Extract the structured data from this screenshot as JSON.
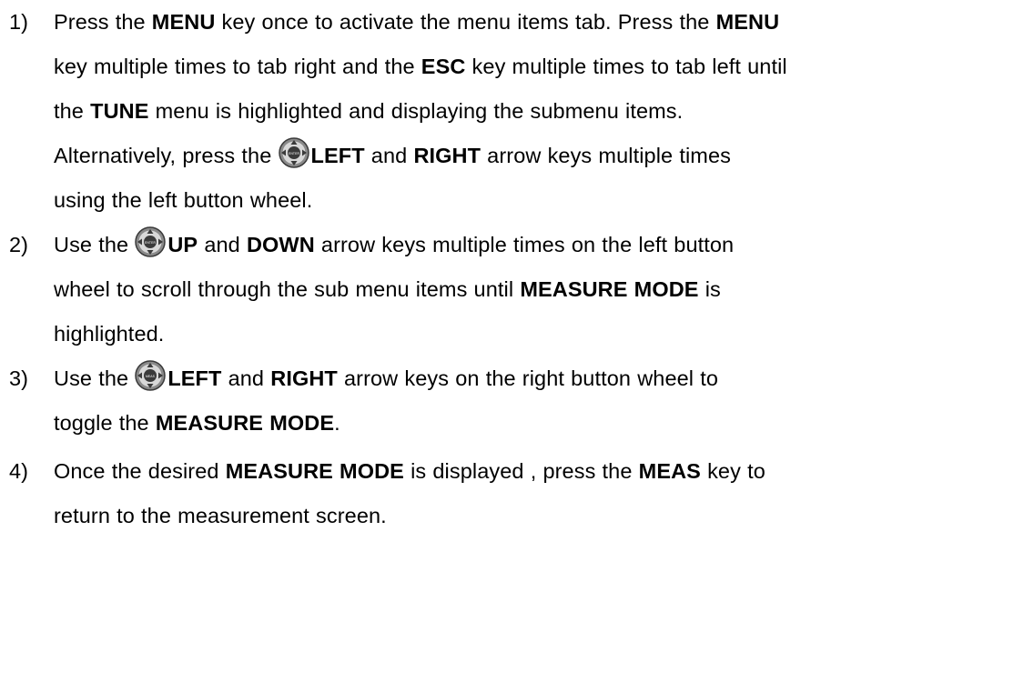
{
  "steps": [
    {
      "number": "1)",
      "lines": [
        [
          {
            "t": "Press the "
          },
          {
            "t": "MENU",
            "b": true
          },
          {
            "t": " key once to activate the menu items tab.  Press the "
          },
          {
            "t": "MENU",
            "b": true
          }
        ],
        [
          {
            "t": "key multiple times to tab right and the "
          },
          {
            "t": "ESC",
            "b": true
          },
          {
            "t": " key multiple times to tab left until"
          }
        ],
        [
          {
            "t": "the "
          },
          {
            "t": "TUNE",
            "b": true
          },
          {
            "t": " menu is highlighted and displaying the submenu items."
          }
        ],
        [
          {
            "t": "Alternatively, press the "
          },
          {
            "icon": "left-button-wheel-icon"
          },
          {
            "t": "LEFT",
            "b": true
          },
          {
            "t": " and "
          },
          {
            "t": "RIGHT",
            "b": true
          },
          {
            "t": " arrow keys multiple times"
          }
        ],
        [
          {
            "t": "using the left button wheel."
          }
        ]
      ]
    },
    {
      "number": "2)",
      "lines": [
        [
          {
            "t": "Use the "
          },
          {
            "icon": "left-button-wheel-icon"
          },
          {
            "t": "UP",
            "b": true
          },
          {
            "t": " and "
          },
          {
            "t": "DOWN",
            "b": true
          },
          {
            "t": " arrow keys multiple times on the left button"
          }
        ],
        [
          {
            "t": "wheel to scroll through the sub menu items until "
          },
          {
            "t": "MEASURE MODE",
            "b": true
          },
          {
            "t": " is"
          }
        ],
        [
          {
            "t": "highlighted."
          }
        ]
      ]
    },
    {
      "number": "3)",
      "lines": [
        [
          {
            "t": "Use the "
          },
          {
            "icon": "right-button-wheel-icon"
          },
          {
            "t": "LEFT",
            "b": true
          },
          {
            "t": " and "
          },
          {
            "t": "RIGHT",
            "b": true
          },
          {
            "t": " arrow keys on the right button wheel to"
          }
        ],
        [
          {
            "t": "toggle the "
          },
          {
            "t": "MEASURE MODE",
            "b": true
          },
          {
            "t": "."
          }
        ]
      ]
    },
    {
      "number": "4)",
      "lines": [
        [
          {
            "t": "Once the desired "
          },
          {
            "t": "MEASURE MODE",
            "b": true
          },
          {
            "t": " is displayed , press the "
          },
          {
            "t": "MEAS",
            "b": true
          },
          {
            "t": " key to"
          }
        ],
        [
          {
            "t": "return to the measurement screen."
          }
        ]
      ]
    }
  ],
  "icons": {
    "left-button-wheel-icon": {
      "label": "ENTER",
      "arrows": [
        "up",
        "down",
        "left",
        "right"
      ]
    },
    "right-button-wheel-icon": {
      "label": "MEAS",
      "arrows": [
        "up",
        "down",
        "left",
        "right"
      ]
    }
  },
  "colors": {
    "text": "#000000",
    "wheel_dark": "#3a3a3a",
    "wheel_mid": "#8a8a8a",
    "wheel_light": "#d8d8d8"
  }
}
